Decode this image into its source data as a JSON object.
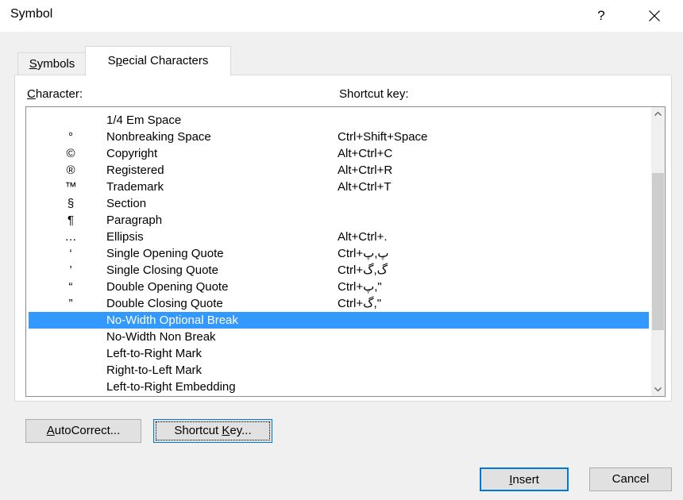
{
  "window": {
    "title": "Symbol",
    "help": "?"
  },
  "tabs": {
    "symbols_u": "S",
    "symbols_rest": "ymbols",
    "special_pre": "S",
    "special_u": "p",
    "special_rest": "ecial Characters"
  },
  "headers": {
    "character_u": "C",
    "character_rest": "haracter:",
    "shortcut": "Shortcut key:"
  },
  "rows": [
    {
      "glyph": "",
      "name": "1/4 Em Space",
      "key": ""
    },
    {
      "glyph": "°",
      "name": "Nonbreaking Space",
      "key": "Ctrl+Shift+Space"
    },
    {
      "glyph": "©",
      "name": "Copyright",
      "key": "Alt+Ctrl+C"
    },
    {
      "glyph": "®",
      "name": "Registered",
      "key": "Alt+Ctrl+R"
    },
    {
      "glyph": "™",
      "name": "Trademark",
      "key": "Alt+Ctrl+T"
    },
    {
      "glyph": "§",
      "name": "Section",
      "key": ""
    },
    {
      "glyph": "¶",
      "name": "Paragraph",
      "key": ""
    },
    {
      "glyph": "…",
      "name": "Ellipsis",
      "key": "Alt+Ctrl+."
    },
    {
      "glyph": "‘",
      "name": "Single Opening Quote",
      "key": "Ctrl+پ,پ"
    },
    {
      "glyph": "’",
      "name": "Single Closing Quote",
      "key": "Ctrl+گ,گ"
    },
    {
      "glyph": "“",
      "name": "Double Opening Quote",
      "key": "Ctrl+پ,\""
    },
    {
      "glyph": "”",
      "name": "Double Closing Quote",
      "key": "Ctrl+گ,\""
    },
    {
      "glyph": "",
      "name": "No-Width Optional Break",
      "key": ""
    },
    {
      "glyph": "",
      "name": "No-Width Non Break",
      "key": ""
    },
    {
      "glyph": "",
      "name": "Left-to-Right Mark",
      "key": ""
    },
    {
      "glyph": "",
      "name": "Right-to-Left Mark",
      "key": ""
    },
    {
      "glyph": "",
      "name": "Left-to-Right Embedding",
      "key": ""
    }
  ],
  "selected_index": 12,
  "scroll": {
    "thumb_start": 0.2,
    "thumb_end": 0.8
  },
  "buttons": {
    "autocorrect_u": "A",
    "autocorrect_rest": "utoCorrect...",
    "shortcut_pre": "Shortcut ",
    "shortcut_u": "K",
    "shortcut_rest": "ey...",
    "insert_u": "I",
    "insert_rest": "nsert",
    "cancel": "Cancel"
  },
  "colors": {
    "selection": "#3399ff",
    "accent": "#0078d7",
    "dialog_bg": "#f0f0f0"
  }
}
